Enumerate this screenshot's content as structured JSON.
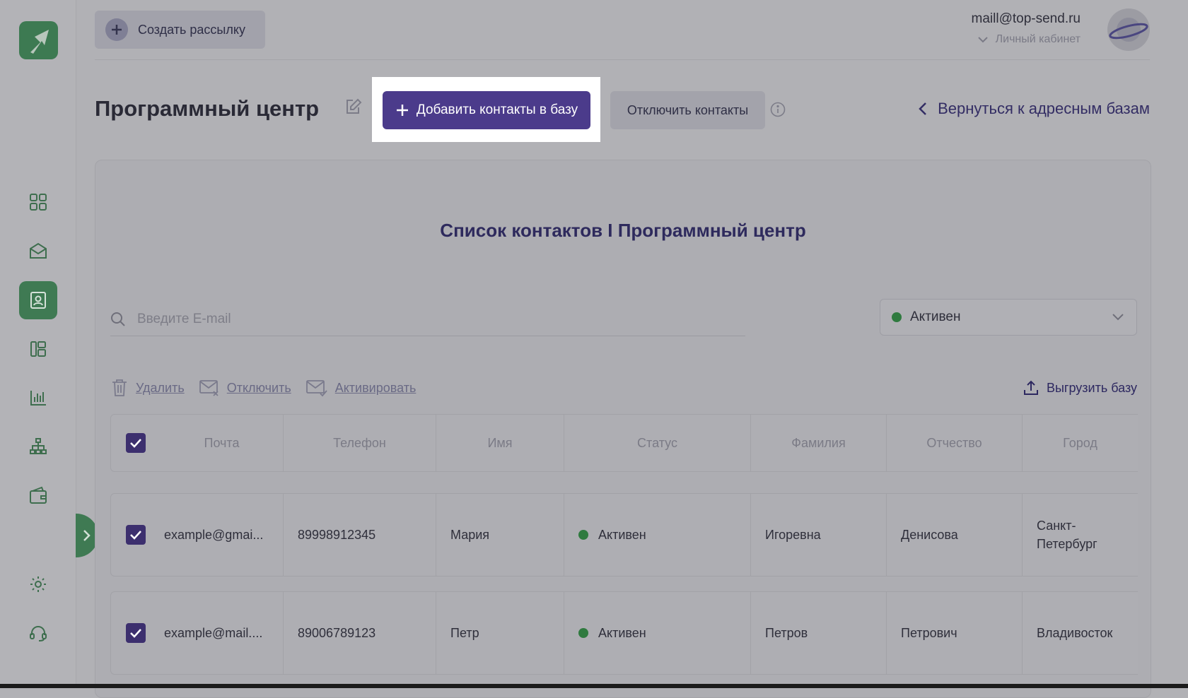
{
  "header": {
    "create_label": "Создать рассылку",
    "user_email": "maill@top-send.ru",
    "cabinet_label": "Личный кабинет"
  },
  "page": {
    "title": "Программный центр",
    "add_contacts_label": "Добавить контакты в базу",
    "disable_contacts_label": "Отключить контакты",
    "back_label": "Вернуться к адресным базам"
  },
  "panel": {
    "list_title": "Список контактов I Программный центр",
    "search_placeholder": "Введите E-mail",
    "status_filter": "Активен",
    "actions": {
      "delete": "Удалить",
      "disable": "Отключить",
      "activate": "Активировать",
      "export": "Выгрузить базу"
    },
    "columns": [
      "Почта",
      "Телефон",
      "Имя",
      "Статус",
      "Фамилия",
      "Отчество",
      "Город"
    ],
    "rows": [
      {
        "email": "example@gmai...",
        "phone": "89998912345",
        "name": "Мария",
        "status": "Активен",
        "last": "Игоревна",
        "middle": "Денисова",
        "city": "Санкт-\nПетербург"
      },
      {
        "email": "example@mail....",
        "phone": "89006789123",
        "name": "Петр",
        "status": "Активен",
        "last": "Петров",
        "middle": "Петрович",
        "city": "Владивосток"
      }
    ]
  },
  "colors": {
    "accent": "#4b3b8b",
    "brand_green": "#3f7a53",
    "status_active": "#2f7a3f"
  }
}
